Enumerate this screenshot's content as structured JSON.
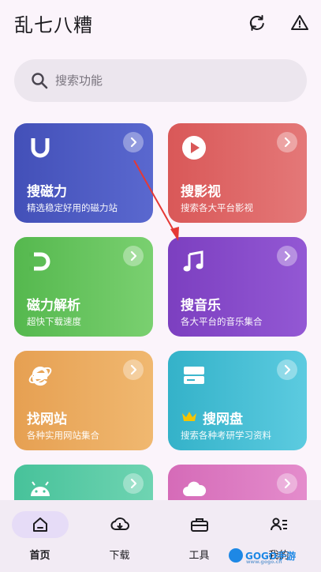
{
  "header": {
    "title": "乱七八糟",
    "refresh_icon": "refresh-icon",
    "warning_icon": "warning-icon"
  },
  "search": {
    "placeholder": "搜索功能"
  },
  "cards": [
    {
      "title": "搜磁力",
      "subtitle": "精选稳定好用的磁力站",
      "icon": "magnet-u-icon",
      "color_from": "#4350b8",
      "color_to": "#5a68cf"
    },
    {
      "title": "搜影视",
      "subtitle": "搜索各大平台影视",
      "icon": "play-circle-icon",
      "color_from": "#d95858",
      "color_to": "#e47878"
    },
    {
      "title": "磁力解析",
      "subtitle": "超快下载速度",
      "icon": "magnet-icon",
      "color_from": "#55b84e",
      "color_to": "#7ad070"
    },
    {
      "title": "搜音乐",
      "subtitle": "各大平台的音乐集合",
      "icon": "music-note-icon",
      "color_from": "#7c3fc0",
      "color_to": "#9358d4"
    },
    {
      "title": "找网站",
      "subtitle": "各种实用网站集合",
      "icon": "browser-e-icon",
      "color_from": "#e6a052",
      "color_to": "#f0b870"
    },
    {
      "title": "搜网盘",
      "subtitle": "搜索各种考研学习资料",
      "icon": "hard-drive-icon",
      "badge_icon": "crown-icon",
      "color_from": "#34b2c9",
      "color_to": "#5ccbe0"
    },
    {
      "title": "",
      "subtitle": "",
      "icon": "android-icon",
      "color_from": "#47c29a",
      "color_to": "#6fd4b2"
    },
    {
      "title": "",
      "subtitle": "",
      "icon": "cloud-icon",
      "color_from": "#d56bb8",
      "color_to": "#e48ccc"
    }
  ],
  "bottom_nav": [
    {
      "label": "首页",
      "icon": "home-icon",
      "active": true
    },
    {
      "label": "下载",
      "icon": "cloud-download-icon",
      "active": false
    },
    {
      "label": "工具",
      "icon": "toolbox-icon",
      "active": false
    },
    {
      "label": "我的",
      "icon": "profile-list-icon",
      "active": false
    }
  ],
  "watermark": {
    "text": "GOGO手游",
    "sub": "www.gogo.cn"
  }
}
